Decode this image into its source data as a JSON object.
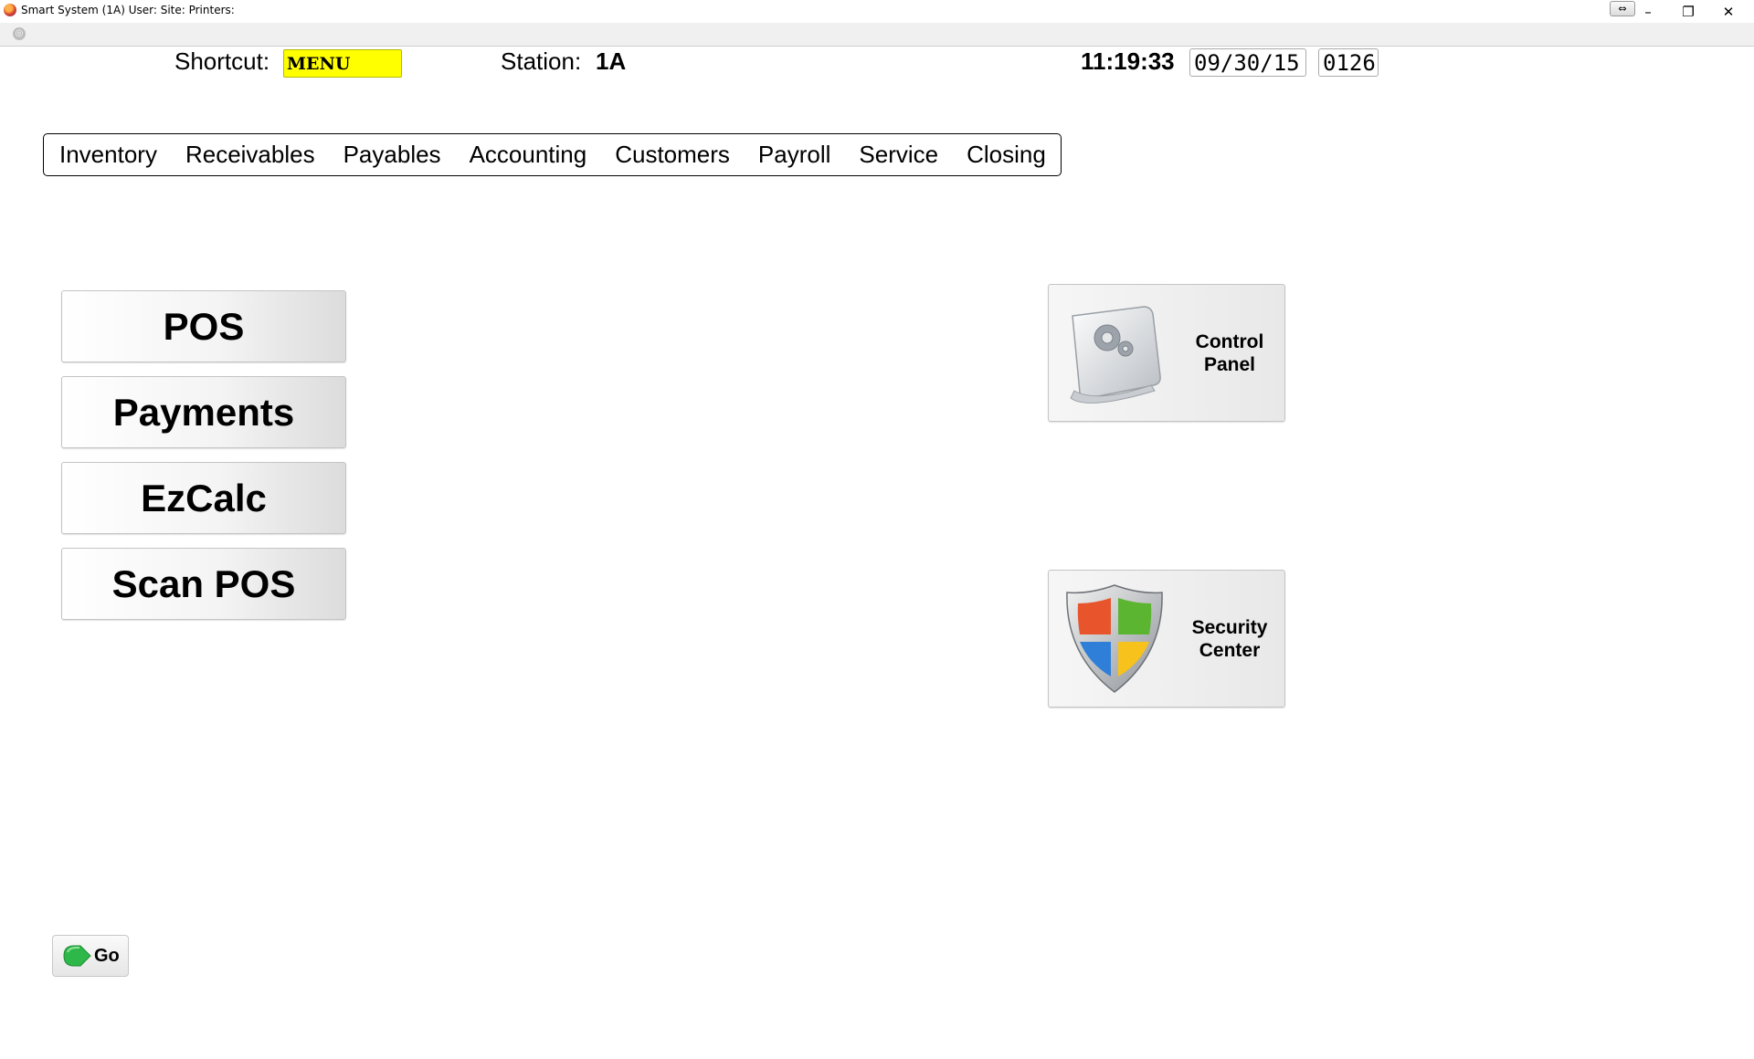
{
  "window": {
    "title": "Smart System (1A) User: Site: Printers:",
    "extra_button_icon": "resize-arrows-icon",
    "minimize_glyph": "–",
    "maximize_glyph": "❐",
    "close_glyph": "✕"
  },
  "toolbar": {
    "icon": "globe-icon"
  },
  "header": {
    "shortcut_label": "Shortcut:",
    "shortcut_value": "MENU",
    "shortcut_color": "#ffff00",
    "station_label": "Station:",
    "station_value": "1A",
    "time": "11:19:33",
    "date": "09/30/15",
    "code": "0126"
  },
  "menu": {
    "items": [
      {
        "label": "Inventory"
      },
      {
        "label": "Receivables"
      },
      {
        "label": "Payables"
      },
      {
        "label": "Accounting"
      },
      {
        "label": "Customers"
      },
      {
        "label": "Payroll"
      },
      {
        "label": "Service"
      },
      {
        "label": "Closing"
      }
    ]
  },
  "main_buttons": [
    {
      "label": "POS"
    },
    {
      "label": "Payments"
    },
    {
      "label": "EzCalc"
    },
    {
      "label": "Scan POS"
    }
  ],
  "tiles": {
    "control_panel": {
      "line1": "Control",
      "line2": "Panel",
      "icon": "gears-icon"
    },
    "security_center": {
      "line1": "Security",
      "line2": "Center",
      "icon": "shield-icon"
    }
  },
  "go_button": {
    "label": "Go",
    "icon": "arrow-right-icon",
    "color": "#2fb84a"
  }
}
